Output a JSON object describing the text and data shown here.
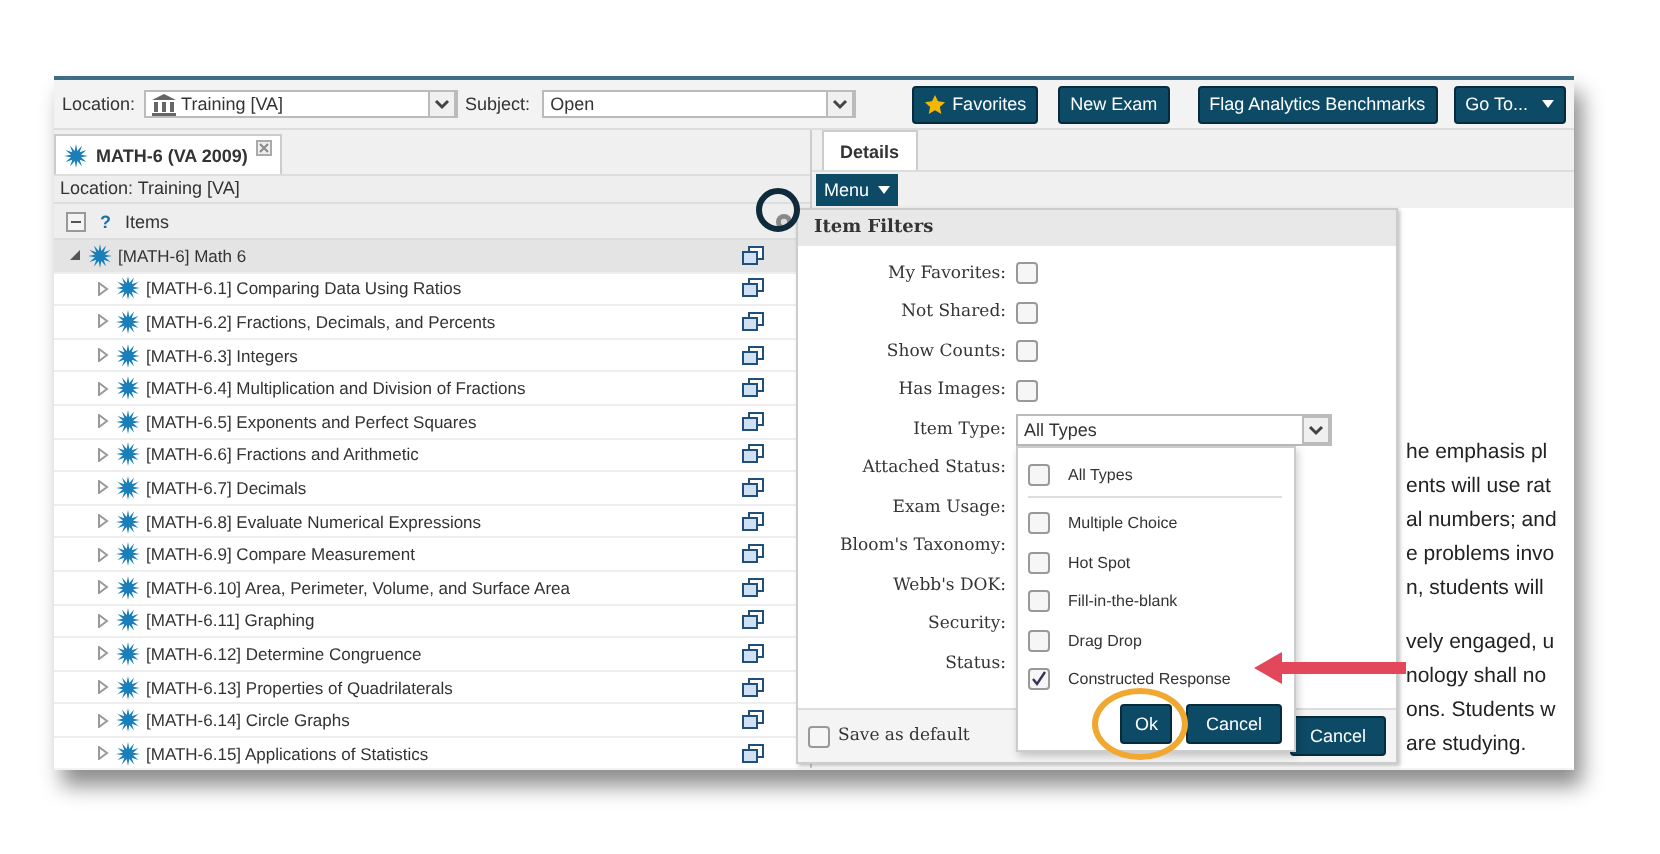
{
  "toolbar": {
    "location_label": "Location:",
    "location_value": "Training [VA]",
    "subject_label": "Subject:",
    "subject_value": "Open",
    "buttons": [
      {
        "label": "Favorites",
        "kind": "star"
      },
      {
        "label": "New Exam",
        "kind": "plain"
      },
      {
        "label": "Flag Analytics Benchmarks",
        "kind": "plain"
      },
      {
        "label": "Go To...",
        "kind": "menu"
      }
    ]
  },
  "left_panel": {
    "tab": {
      "label": "MATH-6 (VA 2009)",
      "selected": true
    },
    "location_text": "Location: Training [VA]",
    "help_glyph": "?",
    "items_header": "Items",
    "tree": {
      "label": "[MATH-6] Math 6",
      "expanded": true,
      "selected": true,
      "children": [
        {
          "label": "[MATH-6.1] Comparing Data Using Ratios",
          "expanded": false,
          "selected": false
        },
        {
          "label": "[MATH-6.2] Fractions, Decimals, and Percents",
          "expanded": false,
          "selected": false
        },
        {
          "label": "[MATH-6.3] Integers",
          "expanded": false,
          "selected": false
        },
        {
          "label": "[MATH-6.4] Multiplication and Division of Fractions",
          "expanded": false,
          "selected": false
        },
        {
          "label": "[MATH-6.5] Exponents and Perfect Squares",
          "expanded": false,
          "selected": false
        },
        {
          "label": "[MATH-6.6] Fractions and Arithmetic",
          "expanded": false,
          "selected": false
        },
        {
          "label": "[MATH-6.7] Decimals",
          "expanded": false,
          "selected": false
        },
        {
          "label": "[MATH-6.8] Evaluate Numerical Expressions",
          "expanded": false,
          "selected": false
        },
        {
          "label": "[MATH-6.9] Compare Measurement",
          "expanded": false,
          "selected": false
        },
        {
          "label": "[MATH-6.10] Area, Perimeter, Volume, and Surface Area",
          "expanded": false,
          "selected": false
        },
        {
          "label": "[MATH-6.11] Graphing",
          "expanded": false,
          "selected": false
        },
        {
          "label": "[MATH-6.12] Determine Congruence",
          "expanded": false,
          "selected": false
        },
        {
          "label": "[MATH-6.13] Properties of Quadrilaterals",
          "expanded": false,
          "selected": false
        },
        {
          "label": "[MATH-6.14] Circle Graphs",
          "expanded": false,
          "selected": false
        },
        {
          "label": "[MATH-6.15] Applications of Statistics",
          "expanded": false,
          "selected": false
        }
      ]
    }
  },
  "right_panel": {
    "tab": {
      "label": "Details",
      "selected": true
    },
    "menu_button": "Menu",
    "paragraphs": [
      [
        "he emphasis pl",
        "ents will use rat",
        "al numbers; and",
        "e problems invo",
        "n, students will"
      ],
      [
        "vely engaged, u",
        "nology shall no",
        "ons. Students w",
        "are studying."
      ]
    ]
  },
  "dialog": {
    "title": "Item Filters",
    "fields": [
      {
        "label": "My Favorites:",
        "kind": "checkbox",
        "checked": false
      },
      {
        "label": "Not Shared:",
        "kind": "checkbox",
        "checked": false
      },
      {
        "label": "Show Counts:",
        "kind": "checkbox",
        "checked": false
      },
      {
        "label": "Has Images:",
        "kind": "checkbox",
        "checked": false
      },
      {
        "label": "Item Type:",
        "kind": "select",
        "value": "All Types"
      },
      {
        "label": "Attached Status:",
        "kind": "label"
      },
      {
        "label": "Exam Usage:",
        "kind": "label"
      },
      {
        "label": "Bloom's Taxonomy:",
        "kind": "label"
      },
      {
        "label": "Webb's DOK:",
        "kind": "label"
      },
      {
        "label": "Security:",
        "kind": "label"
      },
      {
        "label": "Status:",
        "kind": "label"
      }
    ],
    "save_default": {
      "label": "Save as default",
      "checked": false
    },
    "cancel": "Cancel"
  },
  "dropdown": {
    "options": [
      {
        "label": "All Types",
        "checked": false
      },
      {
        "label": "Multiple Choice",
        "checked": false
      },
      {
        "label": "Hot Spot",
        "checked": false
      },
      {
        "label": "Fill-in-the-blank",
        "checked": false
      },
      {
        "label": "Drag Drop",
        "checked": false
      },
      {
        "label": "Constructed Response",
        "checked": true
      }
    ],
    "ok": "Ok",
    "cancel": "Cancel"
  }
}
